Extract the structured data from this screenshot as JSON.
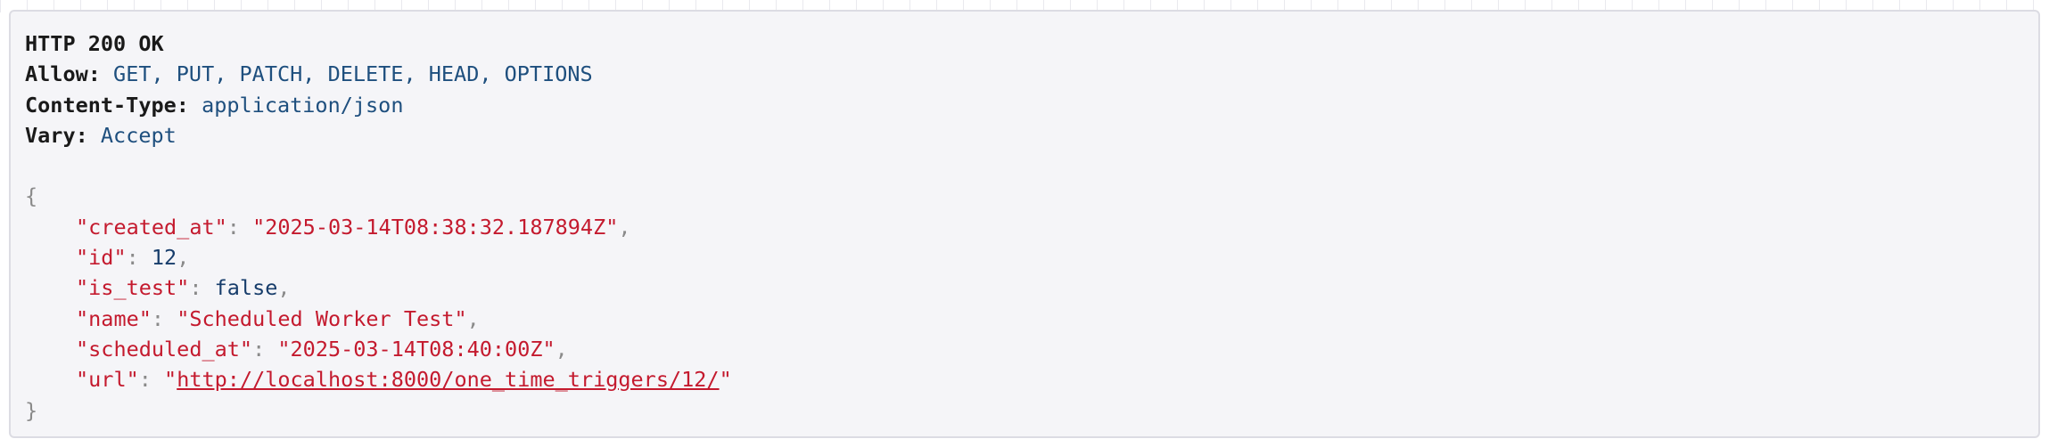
{
  "response": {
    "status": "HTTP 200 OK",
    "headers": [
      {
        "key": "Allow:",
        "value": "GET, PUT, PATCH, DELETE, HEAD, OPTIONS"
      },
      {
        "key": "Content-Type:",
        "value": "application/json"
      },
      {
        "key": "Vary:",
        "value": "Accept"
      }
    ],
    "body": {
      "open_brace": "{",
      "close_brace": "}",
      "fields": [
        {
          "key": "\"created_at\"",
          "value": "\"2025-03-14T08:38:32.187894Z\"",
          "type": "string"
        },
        {
          "key": "\"id\"",
          "value": "12",
          "type": "number"
        },
        {
          "key": "\"is_test\"",
          "value": "false",
          "type": "literal"
        },
        {
          "key": "\"name\"",
          "value": "\"Scheduled Worker Test\"",
          "type": "string"
        },
        {
          "key": "\"scheduled_at\"",
          "value": "\"2025-03-14T08:40:00Z\"",
          "type": "string"
        },
        {
          "key": "\"url\"",
          "value": "http://localhost:8000/one_time_triggers/12/",
          "type": "link"
        }
      ]
    }
  }
}
